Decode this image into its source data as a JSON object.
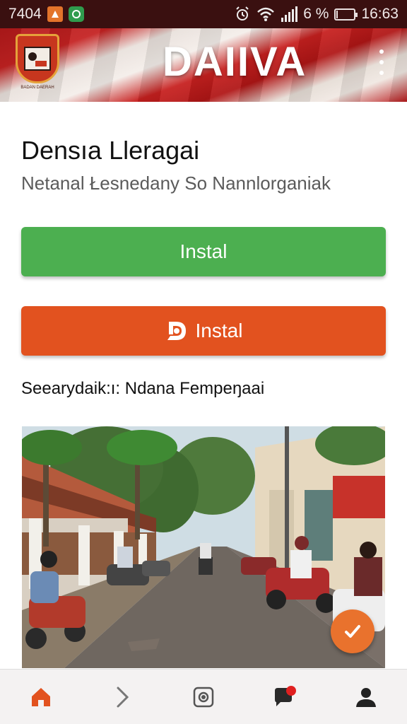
{
  "status_bar": {
    "left_text": "7404",
    "battery_text": "6 %",
    "battery_level": 0.06,
    "time": "16:63",
    "icons": [
      "orange-app-icon",
      "green-app-icon",
      "alarm-icon",
      "wifi-icon",
      "signal-icon",
      "battery-icon"
    ]
  },
  "header": {
    "app_title": "DAIIVA",
    "logo_caption": "BADAN DAERAH",
    "menu_icon": "more-vertical-icon",
    "colors": {
      "red": "#b8191b",
      "white": "#f0e8e2"
    }
  },
  "content": {
    "title": "Densıa Lleragai",
    "subtitle": "Netanal Łesnedany So Nannlorganiak",
    "buttons": [
      {
        "label": "Instal",
        "color": "#4caf50"
      },
      {
        "label": "Instal",
        "color": "#e2521f",
        "icon": "d-logo-icon"
      }
    ],
    "section_caption": "Seearydaik:ı: Ndana Fempeŋaai",
    "image_description_icon": "street-photo",
    "fab_icon": "check-icon",
    "fab_color": "#e9722d"
  },
  "bottom_nav": {
    "items": [
      {
        "icon": "home-icon",
        "active": true,
        "color": "#e2521f"
      },
      {
        "icon": "chevron-right-icon",
        "active": false
      },
      {
        "icon": "camera-icon",
        "active": false
      },
      {
        "icon": "chat-notification-icon",
        "active": false
      },
      {
        "icon": "profile-icon",
        "active": false
      }
    ]
  }
}
